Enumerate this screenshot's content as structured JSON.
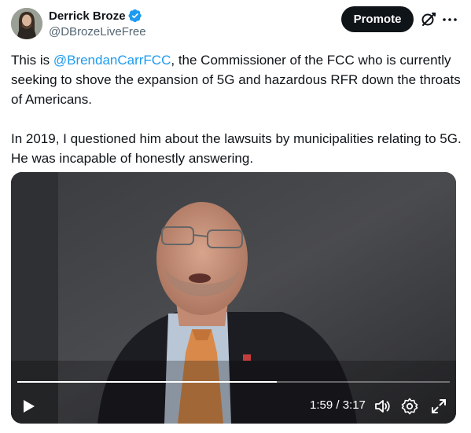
{
  "author": {
    "display_name": "Derrick Broze",
    "handle": "@DBrozeLiveFree",
    "verified": true
  },
  "actions": {
    "promote_label": "Promote",
    "grok_icon": "grok-icon",
    "more_icon": "more-icon"
  },
  "tweet": {
    "text_before": "This is ",
    "mention": "@BrendanCarrFCC",
    "text_after": ", the Commissioner of the FCC who is currently seeking to shove the expansion of 5G and hazardous RFR down the throats of Americans.\n\nIn 2019, I questioned him about the lawsuits by municipalities relating to 5G. He was incapable of honestly answering."
  },
  "video": {
    "time_display": "1:59 / 3:17",
    "progress_fraction": 0.6,
    "controls": {
      "play_icon": "play-icon",
      "volume_icon": "volume-icon",
      "settings_icon": "gear-icon",
      "fullscreen_icon": "expand-icon"
    }
  },
  "colors": {
    "text": "#0f1419",
    "secondary": "#536471",
    "link": "#1d9bf0",
    "verified": "#1d9bf0",
    "button_bg": "#0f1419"
  }
}
